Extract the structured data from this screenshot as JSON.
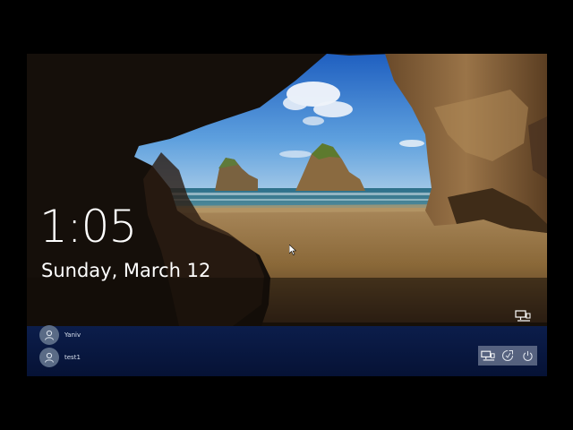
{
  "lockscreen": {
    "time": "1:05",
    "date": "Sunday, March 12"
  },
  "users": [
    {
      "name": "Yaniv"
    },
    {
      "name": "test1"
    }
  ],
  "tray": {
    "icons": [
      "network-icon",
      "ease-of-access-icon",
      "power-icon"
    ]
  }
}
